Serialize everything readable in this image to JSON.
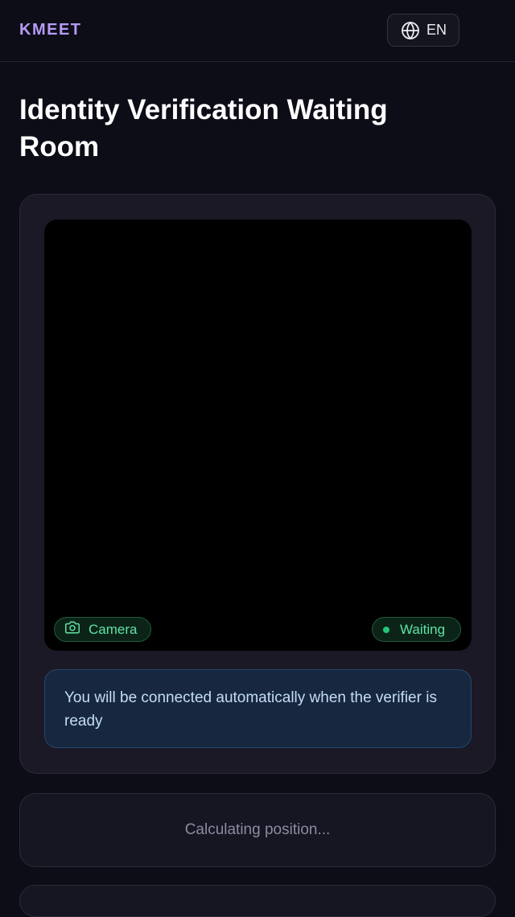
{
  "header": {
    "brand": "KMEET",
    "language": {
      "icon": "globe-icon",
      "label": "EN"
    }
  },
  "page": {
    "title": "Identity Verification Waiting Room"
  },
  "video_panel": {
    "camera_badge": {
      "icon": "camera-icon",
      "label": "Camera"
    },
    "status_badge": {
      "label": "Waiting",
      "dot_color": "#22c577"
    },
    "info_message": "You will be connected automatically when the verifier is ready"
  },
  "queue": {
    "status_text": "Calculating position..."
  },
  "colors": {
    "background": "#0d0d18",
    "brand": "#b59cf5",
    "badge_text": "#5fe3a4",
    "info_background": "#172740",
    "info_text": "#c4dcf5"
  }
}
